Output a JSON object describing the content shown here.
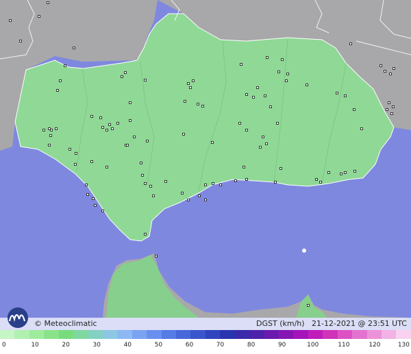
{
  "map": {
    "credit": "© Meteoclimatic",
    "caption": {
      "variable": "DGST (km/h)",
      "date": "21-12-2021",
      "at": "@",
      "time": "23:51 UTC"
    },
    "colors": {
      "sea": "#7f88df",
      "land": "#8fd896",
      "outside_land": "#a8a8aa",
      "border": "#ffffff",
      "station": "#111111"
    },
    "logo_icon": "meteoclimatic-logo-icon",
    "station_icon": "station-marker-icon"
  },
  "legend": {
    "labels": [
      "0",
      "10",
      "20",
      "30",
      "40",
      "50",
      "60",
      "70",
      "80",
      "90",
      "100",
      "110",
      "120",
      "130"
    ],
    "colors": [
      "#c6f5c6",
      "#b2f0b2",
      "#9eeb9e",
      "#8ae38a",
      "#78dc7d",
      "#7fd8a0",
      "#84d0c2",
      "#8cc8e4",
      "#8cb8f4",
      "#7aa4f2",
      "#6890ee",
      "#567ce6",
      "#4668da",
      "#3a56cc",
      "#3044be",
      "#2a34b0",
      "#3a2aaa",
      "#4e22aa",
      "#6a1aae",
      "#8616b4",
      "#a414ba",
      "#c01cbc",
      "#d032b8",
      "#dc52c4",
      "#e472cf",
      "#ec92da",
      "#f2b2e4",
      "#f8d2ee"
    ]
  }
}
